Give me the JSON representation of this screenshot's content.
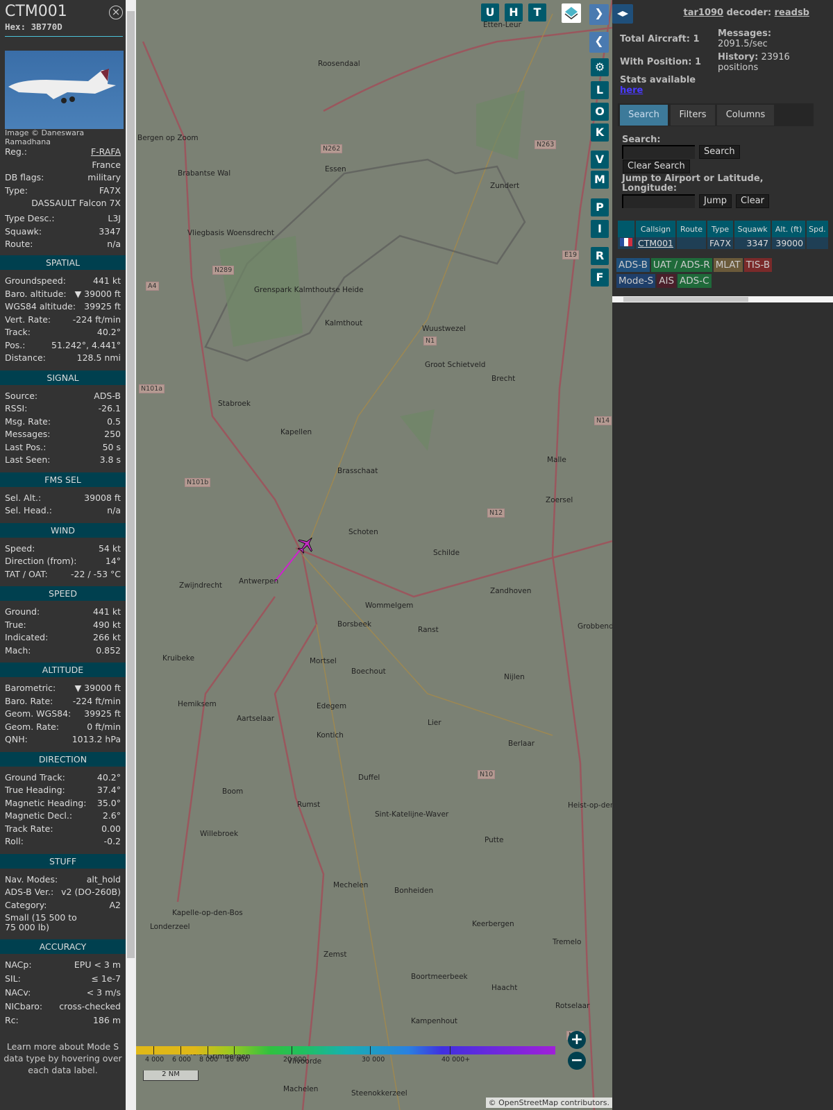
{
  "aircraft": {
    "callsign": "CTM001",
    "hex_label": "Hex: 3B770D",
    "photo_credit": "Image © Daneswara Ramadhana"
  },
  "info_rows": [
    {
      "label": "Reg.:",
      "value": "F-RAFA",
      "link": true
    },
    {
      "label": "",
      "value": "France"
    },
    {
      "label": "DB flags:",
      "value": "military"
    },
    {
      "label": "Type:",
      "value": "FA7X"
    },
    {
      "label": "",
      "value": "DASSAULT Falcon 7X"
    },
    {
      "label": "Type Desc.:",
      "value": "L3J"
    },
    {
      "label": "Squawk:",
      "value": "3347"
    },
    {
      "label": "Route:",
      "value": "n/a"
    }
  ],
  "sections": [
    {
      "title": "SPATIAL",
      "rows": [
        [
          "Groundspeed:",
          "441 kt"
        ],
        [
          "Baro. altitude:",
          "▼ 39000 ft"
        ],
        [
          "WGS84 altitude:",
          "39925 ft"
        ],
        [
          "Vert. Rate:",
          "-224 ft/min"
        ],
        [
          "Track:",
          "40.2°"
        ],
        [
          "Pos.:",
          "51.242°, 4.441°"
        ],
        [
          "Distance:",
          "128.5 nmi"
        ]
      ]
    },
    {
      "title": "SIGNAL",
      "rows": [
        [
          "Source:",
          "ADS-B"
        ],
        [
          "RSSI:",
          "-26.1"
        ],
        [
          "Msg. Rate:",
          "0.5"
        ],
        [
          "Messages:",
          "250"
        ],
        [
          "Last Pos.:",
          "50 s"
        ],
        [
          "Last Seen:",
          "3.8 s"
        ]
      ]
    },
    {
      "title": "FMS SEL",
      "rows": [
        [
          "Sel. Alt.:",
          "39008 ft"
        ],
        [
          "Sel. Head.:",
          "n/a"
        ]
      ]
    },
    {
      "title": "WIND",
      "rows": [
        [
          "Speed:",
          "54 kt"
        ],
        [
          "Direction (from):",
          "14°"
        ],
        [
          "TAT / OAT:",
          "-22 / -53 °C"
        ]
      ]
    },
    {
      "title": "SPEED",
      "rows": [
        [
          "Ground:",
          "441 kt"
        ],
        [
          "True:",
          "490 kt"
        ],
        [
          "Indicated:",
          "266 kt"
        ],
        [
          "Mach:",
          "0.852"
        ]
      ]
    },
    {
      "title": "ALTITUDE",
      "rows": [
        [
          "Barometric:",
          "▼ 39000 ft"
        ],
        [
          "Baro. Rate:",
          "-224 ft/min"
        ],
        [
          "Geom. WGS84:",
          "39925 ft"
        ],
        [
          "Geom. Rate:",
          "0 ft/min"
        ],
        [
          "QNH:",
          "1013.2 hPa"
        ]
      ]
    },
    {
      "title": "DIRECTION",
      "rows": [
        [
          "Ground Track:",
          "40.2°"
        ],
        [
          "True Heading:",
          "37.4°"
        ],
        [
          "Magnetic Heading:",
          "35.0°"
        ],
        [
          "Magnetic Decl.:",
          "2.6°"
        ],
        [
          "Track Rate:",
          "0.00"
        ],
        [
          "Roll:",
          "-0.2"
        ]
      ]
    },
    {
      "title": "STUFF",
      "rows": [
        [
          "Nav. Modes:",
          "alt_hold"
        ],
        [
          "ADS-B Ver.:",
          "v2 (DO-260B)"
        ],
        [
          "Category:",
          "A2"
        ]
      ],
      "note": "Small (15 500 to 75 000 lb)"
    },
    {
      "title": "ACCURACY",
      "rows": [
        [
          "NACp:",
          "EPU < 3 m"
        ],
        [
          "SIL:",
          "≤ 1e-7"
        ],
        [
          "NACv:",
          "< 3 m/s"
        ],
        [
          "NICbaro:",
          "cross-checked"
        ],
        [
          "Rc:",
          "186 m"
        ]
      ]
    }
  ],
  "footer_note": "Learn more about Mode S data type by hovering over each data label.",
  "map": {
    "top_buttons": [
      "U",
      "H",
      "T"
    ],
    "side_buttons": [
      "L",
      "O",
      "K",
      "V",
      "M",
      "P",
      "I",
      "R",
      "F"
    ],
    "places": [
      [
        "Etten-Leur",
        500,
        30
      ],
      [
        "Roosendaal",
        262,
        86
      ],
      [
        "Bergen op Zoom",
        2,
        193
      ],
      [
        "Essen",
        272,
        238
      ],
      [
        "Zundert",
        510,
        262
      ],
      [
        "Brabantse Wal",
        60,
        244
      ],
      [
        "Vliegbasis Woensdrecht",
        74,
        330
      ],
      [
        "Grenspark Kalmthoutse Heide",
        170,
        412
      ],
      [
        "Wuustwezel",
        412,
        468
      ],
      [
        "Kalmthout",
        272,
        460
      ],
      [
        "Groot Schietveld",
        416,
        520
      ],
      [
        "Brecht",
        512,
        540
      ],
      [
        "Stabroek",
        118,
        576
      ],
      [
        "Kapellen",
        208,
        617
      ],
      [
        "Brasschaat",
        290,
        673
      ],
      [
        "Malle",
        592,
        657
      ],
      [
        "Zoersel",
        590,
        715
      ],
      [
        "Schoten",
        306,
        761
      ],
      [
        "Schilde",
        428,
        791
      ],
      [
        "Antwerpen",
        148,
        832
      ],
      [
        "Zwijndrecht",
        62,
        838
      ],
      [
        "Wommelgem",
        330,
        867
      ],
      [
        "Zandhoven",
        510,
        846
      ],
      [
        "Borsbeek",
        290,
        894
      ],
      [
        "Ranst",
        406,
        902
      ],
      [
        "Grobbend",
        636,
        897
      ],
      [
        "Kruibeke",
        38,
        943
      ],
      [
        "Mortsel",
        250,
        947
      ],
      [
        "Boechout",
        310,
        962
      ],
      [
        "Nijlen",
        530,
        970
      ],
      [
        "Edegem",
        260,
        1012
      ],
      [
        "Hemiksem",
        60,
        1009
      ],
      [
        "Aartselaar",
        145,
        1030
      ],
      [
        "Kontich",
        260,
        1054
      ],
      [
        "Lier",
        420,
        1036
      ],
      [
        "Berlaar",
        536,
        1066
      ],
      [
        "Duffel",
        320,
        1115
      ],
      [
        "Boom",
        124,
        1135
      ],
      [
        "Rumst",
        232,
        1154
      ],
      [
        "Heist-op-den Berg",
        622,
        1155
      ],
      [
        "Sint-Katelijne-Waver",
        344,
        1168
      ],
      [
        "Willebroek",
        92,
        1196
      ],
      [
        "Putte",
        502,
        1205
      ],
      [
        "Mechelen",
        284,
        1270
      ],
      [
        "Bonheiden",
        372,
        1278
      ],
      [
        "Kapelle-op-den-Bos",
        52,
        1310
      ],
      [
        "Keerbergen",
        484,
        1326
      ],
      [
        "Londerzeel",
        20,
        1330
      ],
      [
        "Tremelo",
        600,
        1352
      ],
      [
        "Zemst",
        270,
        1370
      ],
      [
        "Boortmeerbeek",
        396,
        1402
      ],
      [
        "Haacht",
        512,
        1418
      ],
      [
        "Rotselaar",
        604,
        1444
      ],
      [
        "Kampenhout",
        396,
        1466
      ],
      [
        "Meise",
        72,
        1512
      ],
      [
        "Grimbergen",
        102,
        1517
      ],
      [
        "Vilvoorde",
        218,
        1524
      ],
      [
        "Machelen",
        212,
        1564
      ],
      [
        "Steenokkerzeel",
        310,
        1570
      ]
    ],
    "roads": [
      "N262",
      "N263",
      "A4",
      "N289",
      "N1",
      "N101a",
      "N101b",
      "N12",
      "N14",
      "E19",
      "N10",
      "N26"
    ],
    "colorbar_labels": [
      "4 000",
      "6 000",
      "8 000",
      "10 000",
      "20 000",
      "30 000",
      "40 000+"
    ],
    "scale": "2 NM",
    "attribution_prefix": "© ",
    "attribution_link": "OpenStreetMap",
    "attribution_suffix": " contributors."
  },
  "right": {
    "header_link1": "tar1090",
    "header_mid": " decoder: ",
    "header_link2": "readsb",
    "total_aircraft": "Total Aircraft: 1",
    "with_position": "With Position: 1",
    "messages_label": "Messages:",
    "messages_value": "2091.5/sec",
    "history_label": "History:",
    "history_value": " 23916 positions",
    "stats_text": "Stats available",
    "stats_link": "here",
    "tabs": [
      "Search",
      "Filters",
      "Columns"
    ],
    "search_label": "Search:",
    "search_button": "Search",
    "clear_search": "Clear Search",
    "jump_label": "Jump to Airport or Latitude, Longitude:",
    "jump_button": "Jump",
    "clear_button": "Clear",
    "table_headers": [
      "",
      "Callsign",
      "Route",
      "Type",
      "Squawk",
      "Alt. (ft)",
      "Spd."
    ],
    "table_row": [
      "",
      "CTM001",
      "",
      "FA7X",
      "3347",
      "39000",
      ""
    ],
    "badges": [
      [
        "ADS-B",
        "#1f4f7a"
      ],
      [
        "UAT / ADS-R",
        "#1f6a3a"
      ],
      [
        "MLAT",
        "#6a5a3a"
      ],
      [
        "TIS-B",
        "#7a2a2a"
      ],
      [
        "Mode-S",
        "#1f3f6a"
      ],
      [
        "AIS",
        "#4a1f2a"
      ],
      [
        "ADS-C",
        "#1f6a3a"
      ]
    ]
  }
}
